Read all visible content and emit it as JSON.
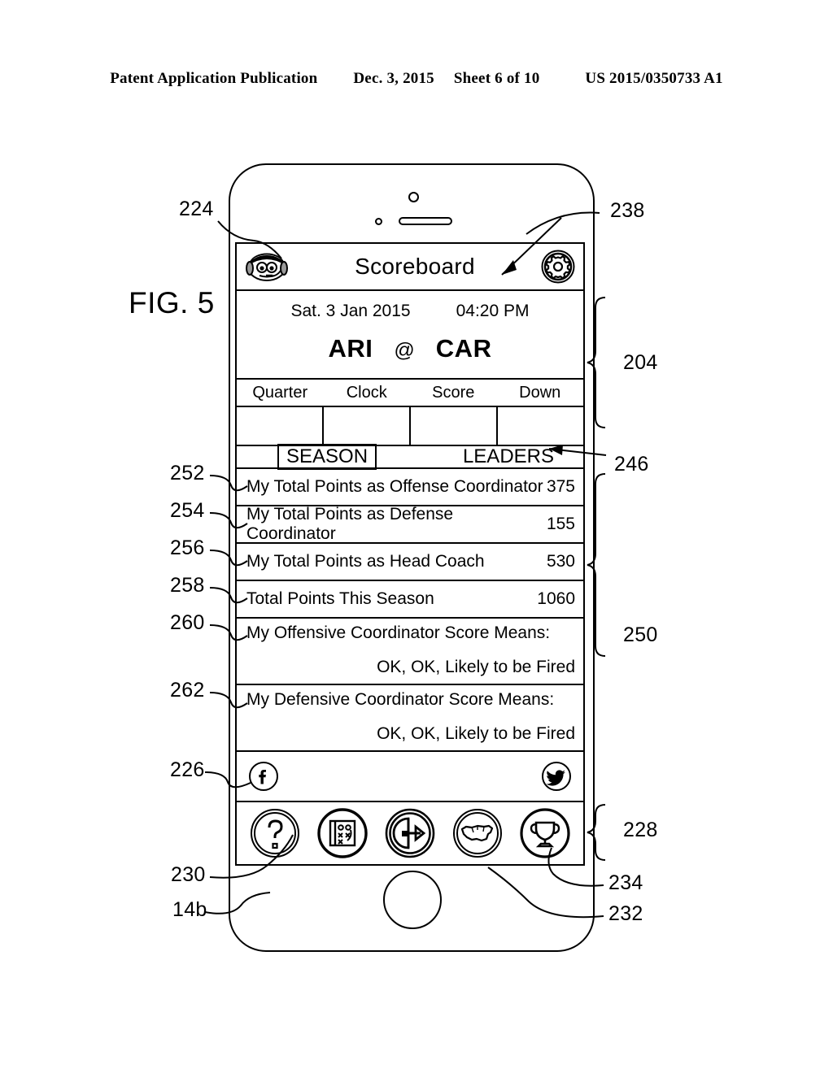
{
  "publication_header": {
    "title": "Patent Application Publication",
    "date": "Dec. 3, 2015",
    "sheet": "Sheet 6 of 10",
    "number": "US 2015/0350733 A1"
  },
  "figure": {
    "label": "FIG. 5"
  },
  "device": {
    "app_bar": {
      "avatar_icon": "coach-mascot-icon",
      "title": "Scoreboard",
      "settings_icon": "gear-icon"
    },
    "scoreboard": {
      "date": "Sat. 3 Jan 2015",
      "time": "04:20 PM",
      "away_team": "ARI",
      "at": "@",
      "home_team": "CAR",
      "columns": [
        "Quarter",
        "Clock",
        "Score",
        "Down"
      ],
      "cells": [
        "",
        "",
        "",
        ""
      ]
    },
    "tabs": {
      "selected": "SEASON",
      "items": [
        "SEASON",
        "LEADERS"
      ]
    },
    "stats": [
      {
        "label": "My Total Points as Offense Coordinator",
        "value": "375"
      },
      {
        "label": "My Total Points as Defense Coordinator",
        "value": "155"
      },
      {
        "label": "My Total Points as Head Coach",
        "value": "530"
      },
      {
        "label": "Total Points This Season",
        "value": "1060"
      }
    ],
    "score_means": [
      {
        "label": "My Offensive Coordinator Score Means:",
        "value": "OK, OK, Likely to be Fired"
      },
      {
        "label": "My Defensive Coordinator Score Means:",
        "value": "OK, OK, Likely to be Fired"
      }
    ],
    "social": {
      "facebook_icon": "facebook-icon",
      "twitter_icon": "twitter-icon"
    },
    "toolbar": [
      {
        "icon": "question-mark-icon"
      },
      {
        "icon": "playbook-icon"
      },
      {
        "icon": "play-football-icon"
      },
      {
        "icon": "us-map-icon"
      },
      {
        "icon": "trophy-icon"
      }
    ]
  },
  "reference_numerals": {
    "avatar": "224",
    "settings_arrow": "238",
    "scoreboard_bracket": "204",
    "leaders_tab": "246",
    "offense_points_row": "252",
    "defense_points_row": "254",
    "head_coach_points_row": "256",
    "total_points_row": "258",
    "offense_means_row": "260",
    "defense_means_row": "262",
    "stats_bracket": "250",
    "social_row": "226",
    "toolbar_bracket": "228",
    "playbook_button": "230",
    "map_button": "232",
    "trophy_button": "234",
    "device": "14b"
  }
}
